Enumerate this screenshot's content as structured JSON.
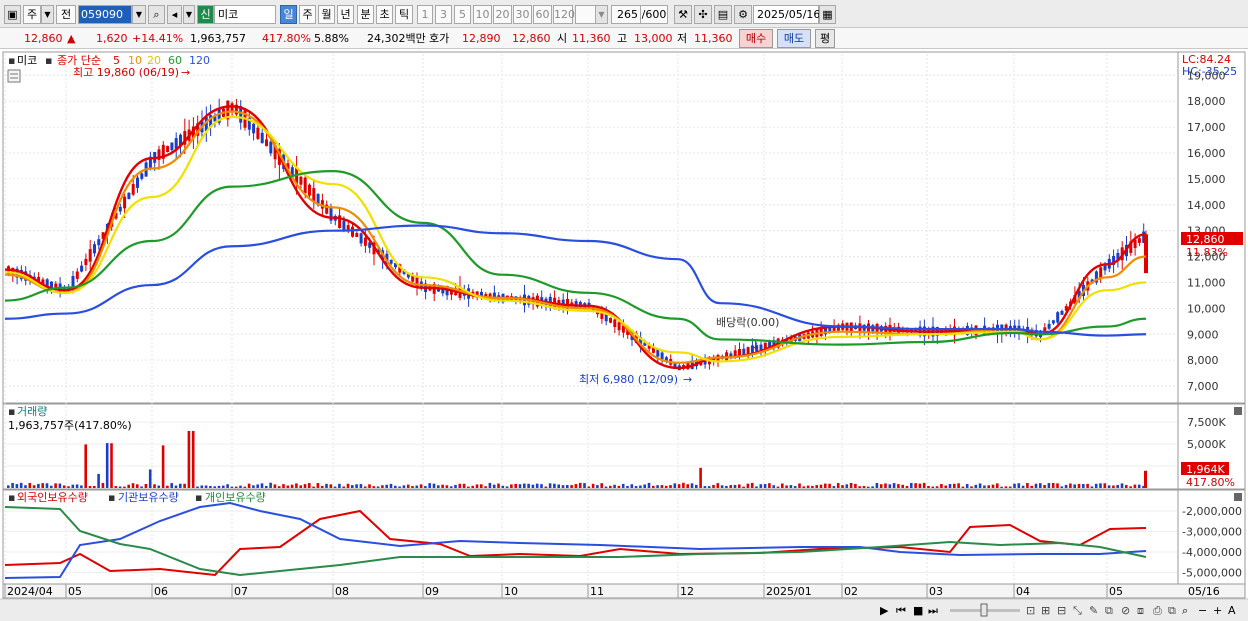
{
  "toolbar": {
    "market": "주",
    "prev": "전",
    "code": "059090",
    "badge": "신",
    "name": "미코",
    "periods": [
      "일",
      "주",
      "월",
      "년",
      "분",
      "초",
      "틱"
    ],
    "minutes": [
      "1",
      "3",
      "5",
      "10",
      "20",
      "30",
      "60",
      "120"
    ],
    "count": "265",
    "count_max": "/600",
    "date": "2025/05/16"
  },
  "info": {
    "price": "12,860",
    "change": "1,620",
    "change_pct": "+14.41%",
    "volume": "1,963,757",
    "vol_ratio": "417.80%",
    "turnover_pct": "5.88%",
    "amount": "24,302백만",
    "ask_label": "호가",
    "ask": "12,890",
    "bid": "12,860",
    "open_label": "시",
    "open": "11,360",
    "high_label": "고",
    "high": "13,000",
    "low_label": "저",
    "low": "11,360",
    "buy_btn": "매수",
    "sell_btn": "매도",
    "eval_btn": "평"
  },
  "price_pane": {
    "stock_label": "미코",
    "ma_title": "종가 단순",
    "ma_periods": [
      "5",
      "10",
      "20",
      "60",
      "120"
    ],
    "high_annot": "최고 19,860 (06/19)",
    "low_annot": "최저 6,980 (12/09)",
    "div_annot": "배당락(0.00)",
    "lc": "LC:84.24",
    "hc": "HC:-35.25",
    "current_price_tag": "12,860",
    "current_pct": "11.83%",
    "y_ticks": [
      "19,000",
      "18,000",
      "17,000",
      "16,000",
      "15,000",
      "14,000",
      "13,000",
      "12,000",
      "11,000",
      "10,000",
      "9,000",
      "8,000",
      "7,000"
    ]
  },
  "volume_pane": {
    "title": "거래량",
    "value": "1,963,757주(417.80%)",
    "y_ticks": [
      "7,500K",
      "5,000K",
      "2,500K"
    ],
    "tag": "1,964K",
    "tag_pct": "417.80%"
  },
  "holding_pane": {
    "legend": [
      "외국인보유수량",
      "기관보유수량",
      "개인보유수량"
    ],
    "y_ticks": [
      "-2,000,000",
      "-3,000,000",
      "-4,000,000",
      "-5,000,000"
    ]
  },
  "x_axis": [
    "2024/04",
    "05",
    "06",
    "07",
    "08",
    "09",
    "10",
    "11",
    "12",
    "2025/01",
    "02",
    "03",
    "04",
    "05",
    "05/16"
  ],
  "colors": {
    "ma5": "#e00000",
    "ma10": "#f08c00",
    "ma20": "#f0e000",
    "ma60": "#1e9a28",
    "ma120": "#2a4fe0",
    "up": "#e00000",
    "down": "#1a3ec8"
  },
  "chart_data": {
    "type": "line",
    "title": "",
    "x": [
      "2024/04",
      "05",
      "06",
      "07",
      "08",
      "09",
      "10",
      "11",
      "12",
      "2025/01",
      "02",
      "03",
      "04",
      "05",
      "05/16"
    ],
    "price_range": [
      6500,
      19900
    ],
    "series": [
      {
        "name": "5",
        "values": [
          11500,
          10700,
          15800,
          17800,
          13500,
          10800,
          10400,
          10100,
          7700,
          8100,
          9300,
          9100,
          9200,
          9000,
          11700,
          12860
        ]
      },
      {
        "name": "10",
        "values": [
          11300,
          10600,
          15400,
          17600,
          13900,
          10900,
          10400,
          10000,
          7900,
          8100,
          9100,
          9000,
          9200,
          8800,
          11200,
          12000
        ]
      },
      {
        "name": "20",
        "values": [
          11400,
          10600,
          14300,
          17400,
          14800,
          11200,
          10300,
          9900,
          8300,
          7950,
          8900,
          9000,
          9100,
          8800,
          10700,
          11000
        ]
      },
      {
        "name": "60",
        "values": [
          10300,
          10800,
          12600,
          14700,
          15300,
          13300,
          11300,
          10600,
          9600,
          8800,
          8600,
          8700,
          9050,
          9000,
          9300,
          9600
        ]
      },
      {
        "name": "120",
        "values": [
          9600,
          9800,
          10900,
          12400,
          13000,
          13200,
          12900,
          12600,
          11900,
          10200,
          9300,
          9200,
          9200,
          9100,
          8950,
          9000
        ]
      }
    ]
  }
}
